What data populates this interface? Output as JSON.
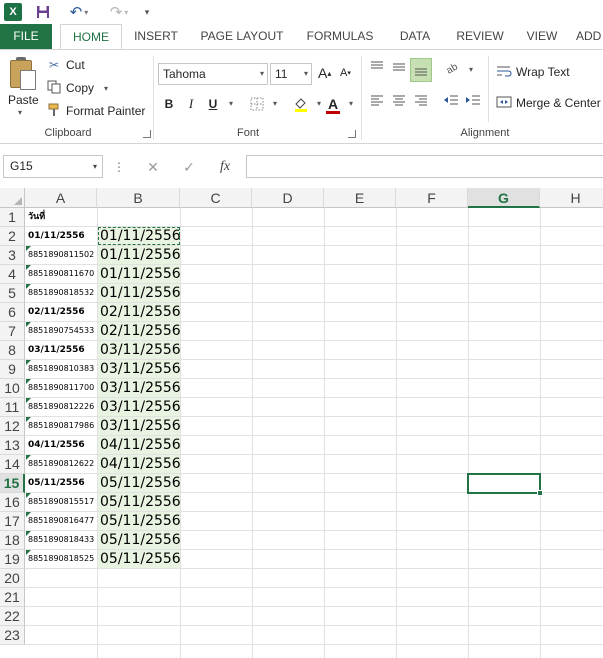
{
  "qat": {
    "logo": "X",
    "save_icon": "save-icon",
    "undo_icon": "↶",
    "redo_icon": "↷",
    "customize_icon": "▾"
  },
  "tabs": [
    {
      "label": "FILE"
    },
    {
      "label": "HOME"
    },
    {
      "label": "INSERT"
    },
    {
      "label": "PAGE LAYOUT"
    },
    {
      "label": "FORMULAS"
    },
    {
      "label": "DATA"
    },
    {
      "label": "REVIEW"
    },
    {
      "label": "VIEW"
    },
    {
      "label": "ADD"
    }
  ],
  "ribbon": {
    "clipboard": {
      "paste": "Paste",
      "cut": "Cut",
      "copy": "Copy",
      "format_painter": "Format Painter",
      "label": "Clipboard"
    },
    "font": {
      "font_name": "Tahoma",
      "font_size": "11",
      "grow": "A",
      "shrink": "A",
      "bold": "B",
      "italic": "I",
      "underline": "U",
      "font_color_letter": "A",
      "label": "Font",
      "font_color": "#c00000"
    },
    "alignment": {
      "wrap_text": "Wrap Text",
      "merge_center": "Merge & Center",
      "label": "Alignment"
    }
  },
  "formula_bar": {
    "name_box": "G15",
    "cancel_icon": "✕",
    "enter_icon": "✓",
    "fx": "fx",
    "formula": ""
  },
  "grid": {
    "columns": [
      "A",
      "B",
      "C",
      "D",
      "E",
      "F",
      "G",
      "H"
    ],
    "rows": [
      "1",
      "2",
      "3",
      "4",
      "5",
      "6",
      "7",
      "8",
      "9",
      "10",
      "11",
      "12",
      "13",
      "14",
      "15",
      "16",
      "17",
      "18",
      "19",
      "20",
      "21",
      "22",
      "23"
    ],
    "selected_column": "G",
    "selected_row": "15",
    "colA": [
      "วันที่",
      "01/11/2556",
      "8851890811502",
      "8851890811670",
      "8851890818532",
      "02/11/2556",
      "8851890754533",
      "03/11/2556",
      "8851890810383",
      "8851890811700",
      "8851890812226",
      "8851890817986",
      "04/11/2556",
      "8851890812622",
      "05/11/2556",
      "8851890815517",
      "8851890816477",
      "8851890818433",
      "8851890818525"
    ],
    "colB": [
      "",
      "01/11/2556",
      "01/11/2556",
      "01/11/2556",
      "01/11/2556",
      "02/11/2556",
      "02/11/2556",
      "03/11/2556",
      "03/11/2556",
      "03/11/2556",
      "03/11/2556",
      "03/11/2556",
      "04/11/2556",
      "04/11/2556",
      "05/11/2556",
      "05/11/2556",
      "05/11/2556",
      "05/11/2556",
      "05/11/2556"
    ],
    "accent": "#217346"
  }
}
